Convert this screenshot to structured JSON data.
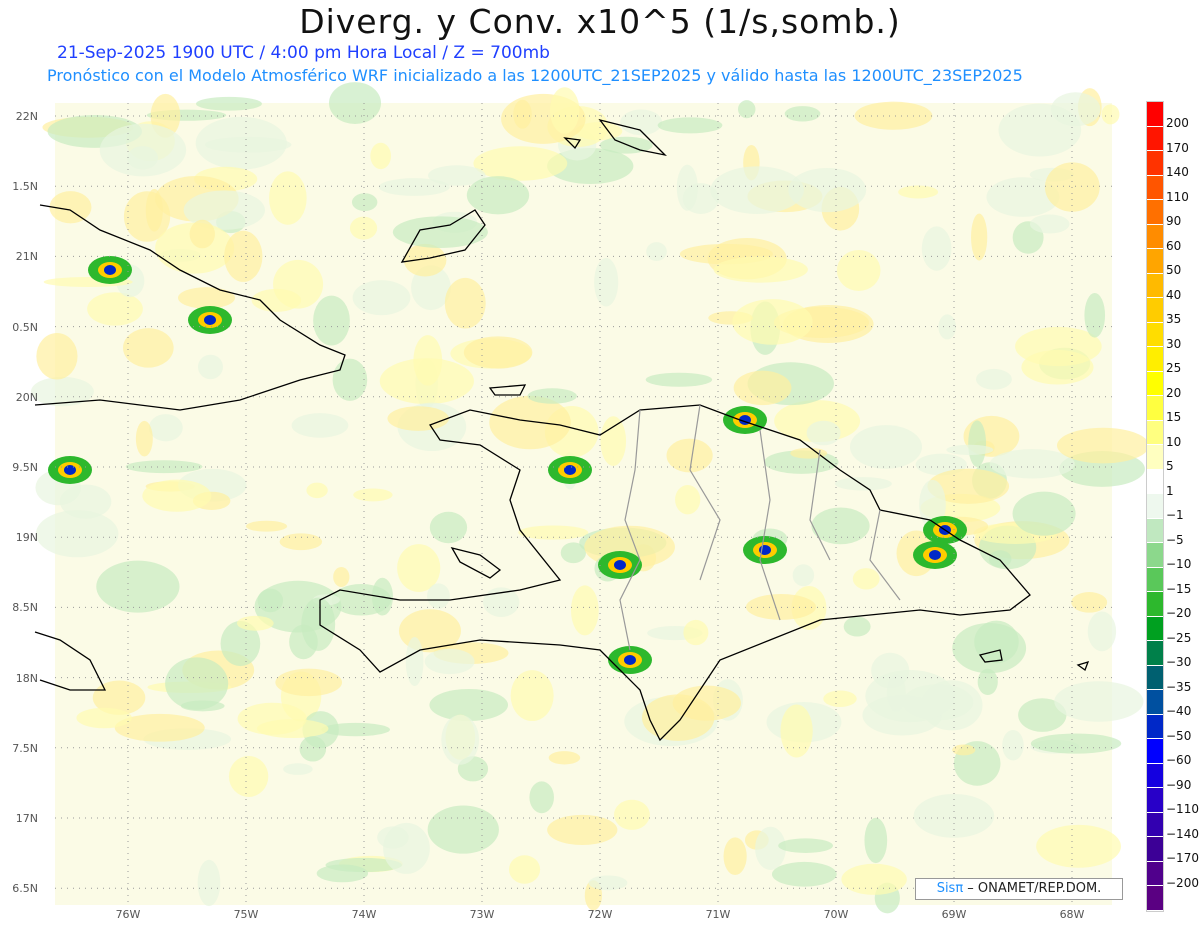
{
  "header": {
    "title": "Diverg. y Conv. x10^5 (1/s,somb.)",
    "subtitle_date": "21-Sep-2025  1900 UTC / 4:00 pm Hora Local / Z = 700mb",
    "subtitle_model": "Pronóstico con el Modelo Atmosférico WRF inicializado a las 1200UTC_21SEP2025 y válido hasta las  1200UTC_23SEP2025"
  },
  "axes": {
    "lat_labels": [
      "22N",
      "1.5N",
      "21N",
      "0.5N",
      "20N",
      "9.5N",
      "19N",
      "8.5N",
      "18N",
      "7.5N",
      "17N",
      "6.5N"
    ],
    "lon_labels": [
      "76W",
      "75W",
      "74W",
      "73W",
      "72W",
      "71W",
      "70W",
      "69W",
      "68W"
    ]
  },
  "colorbar": {
    "labels": [
      "200",
      "170",
      "140",
      "110",
      "90",
      "60",
      "50",
      "40",
      "35",
      "30",
      "25",
      "20",
      "15",
      "10",
      "5",
      "1",
      "−1",
      "−5",
      "−10",
      "−15",
      "−20",
      "−25",
      "−30",
      "−35",
      "−40",
      "−50",
      "−60",
      "−90",
      "−110",
      "−140",
      "−170",
      "−200"
    ],
    "colors": [
      "#ff0000",
      "#ff1500",
      "#ff3300",
      "#ff5500",
      "#ff7000",
      "#ff8c00",
      "#ffa500",
      "#ffba00",
      "#ffcc00",
      "#ffdd00",
      "#ffee00",
      "#ffff00",
      "#ffff40",
      "#ffff80",
      "#ffffc0",
      "#ffffff",
      "#eef8ee",
      "#c0e8c0",
      "#8cd88c",
      "#5ac85a",
      "#2db82d",
      "#00a020",
      "#00804a",
      "#006070",
      "#0050a0",
      "#0028c8",
      "#0000ff",
      "#1400e0",
      "#2800c8",
      "#3200b0",
      "#3c0096",
      "#50008c",
      "#5a0082"
    ]
  },
  "watermark": {
    "brand": "Sisπ",
    "text": " – ONAMET/REP.DOM."
  }
}
